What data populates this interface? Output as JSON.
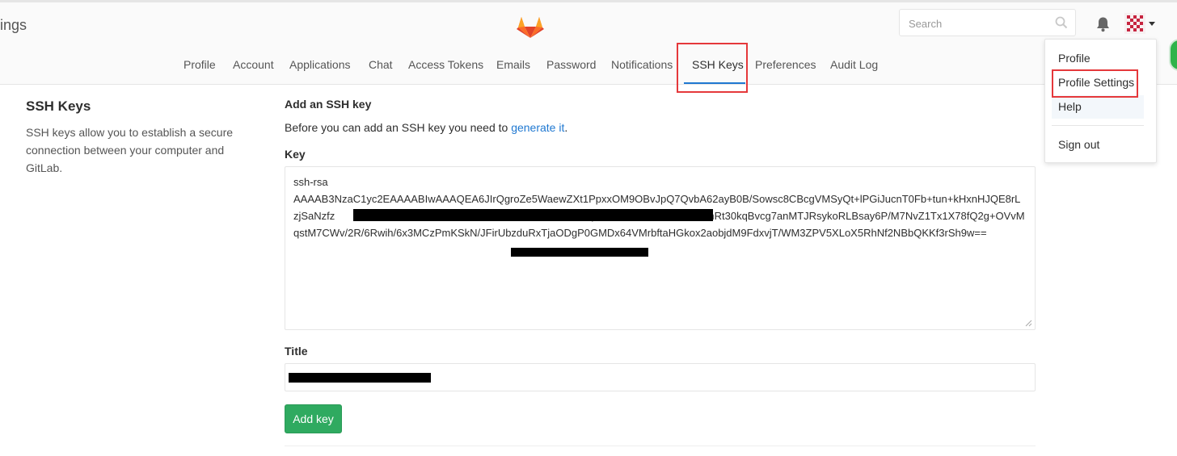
{
  "header": {
    "partial_title": "ings",
    "search": {
      "placeholder": "Search"
    },
    "icons": {
      "logo": "gitlab-tanuki-icon",
      "search": "search-icon",
      "bell": "bell-icon",
      "avatar": "avatar",
      "caret": "chevron-down-icon"
    }
  },
  "nav": {
    "items": [
      {
        "label": "Profile"
      },
      {
        "label": "Account"
      },
      {
        "label": "Applications"
      },
      {
        "label": "Chat"
      },
      {
        "label": "Access Tokens"
      },
      {
        "label": "Emails"
      },
      {
        "label": "Password"
      },
      {
        "label": "Notifications"
      },
      {
        "label": "SSH Keys",
        "active": true
      },
      {
        "label": "Preferences"
      },
      {
        "label": "Audit Log"
      }
    ]
  },
  "user_menu": {
    "items": [
      {
        "label": "Profile"
      },
      {
        "label": "Profile Settings"
      },
      {
        "label": "Help"
      },
      {
        "label": "Sign out"
      }
    ]
  },
  "sidebar": {
    "title": "SSH Keys",
    "description": "SSH keys allow you to establish a secure connection between your computer and GitLab."
  },
  "form": {
    "heading": "Add an SSH key",
    "intro_prefix": "Before you can add an SSH key you need to ",
    "intro_link": "generate it",
    "intro_suffix": ".",
    "key_label": "Key",
    "key_value": "ssh-rsa\nAAAAB3NzaC1yc2EAAAABIwAAAQEA6JIrQgroZe5WaewZXt1PpxxOM9OBvJpQ7QvbA62ayB0B/Sowsc8CBcgVMSyQt+lPGiJucnT0Fb+tun+kHxnHJQE8rLzjSaNzfz                                                                                    6vpPAiPMu7lioLDMhCrFJVhRt30kqBvcg7anMTJRsykoRLBsay6P/M7NvZ1Tx1X78fQ2g+OVvMqstM7CWv/2R/6Rwih/6x3MCzPmKSkN/JFirUbzduRxTjaODgP0GMDx64VMrbftaHGkox2aobjdM9FdxvjT/WM3ZPV5XLoX5RhNf2NBbQKKf3rSh9w==",
    "title_label": "Title",
    "title_value": "",
    "submit_label": "Add key"
  },
  "colors": {
    "accent_blue": "#1f78d1",
    "button_green": "#2faa60",
    "highlight_red": "#e5383b",
    "logo_orange": "#fc6d26"
  }
}
